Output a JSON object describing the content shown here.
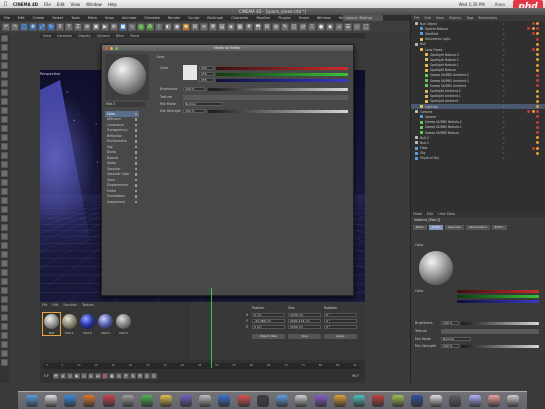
{
  "menubar": {
    "apple": "",
    "app": "CINEMA 4D",
    "items": [
      "File",
      "Edit",
      "View",
      "Window",
      "Help"
    ],
    "right": [
      "Wed 1:30 PM",
      "Anon"
    ]
  },
  "brand": {
    "logo": "phd"
  },
  "window": {
    "title": "CINEMA 4D - [space_scene.c4d *]"
  },
  "c4dmenu": {
    "items": [
      "File",
      "Edit",
      "Create",
      "Select",
      "Tools",
      "Mesh",
      "Snap",
      "Animate",
      "Simulate",
      "Render",
      "Sculpt",
      "MoGraph",
      "Character",
      "Pipeline",
      "Plugins",
      "Script",
      "Window",
      "Help"
    ],
    "layout": "Layout: Startup"
  },
  "viewport": {
    "menu": [
      "View",
      "Cameras",
      "Display",
      "Options",
      "Filter",
      "Panel"
    ],
    "label": "Perspective"
  },
  "material_editor": {
    "title": "Material Editor",
    "name": "Mat.3",
    "channels": [
      {
        "name": "Color",
        "on": true,
        "sel": true
      },
      {
        "name": "Diffusion",
        "on": false
      },
      {
        "name": "Luminance",
        "on": false
      },
      {
        "name": "Transparency",
        "on": false
      },
      {
        "name": "Reflection",
        "on": false
      },
      {
        "name": "Environment",
        "on": false
      },
      {
        "name": "Fog",
        "on": false
      },
      {
        "name": "Bump",
        "on": false
      },
      {
        "name": "Normal",
        "on": false
      },
      {
        "name": "Alpha",
        "on": false
      },
      {
        "name": "Specular",
        "on": true
      },
      {
        "name": "Specular Color",
        "on": false
      },
      {
        "name": "Glow",
        "on": false
      },
      {
        "name": "Displacement",
        "on": false
      },
      {
        "name": "Editor",
        "on": false
      },
      {
        "name": "Illumination",
        "on": false
      },
      {
        "name": "Assignment",
        "on": false
      }
    ],
    "section": "Color",
    "color_label": "Color",
    "r": "255",
    "g": "255",
    "b": "255",
    "brightness_label": "Brightness",
    "brightness": "100 %",
    "texture_label": "Texture",
    "mix_mode_label": "Mix Mode",
    "mix_mode": "Normal",
    "mix_strength_label": "Mix Strength",
    "mix_strength": "100 %"
  },
  "object_manager": {
    "menu": [
      "File",
      "Edit",
      "View",
      "Objects",
      "Tags",
      "Bookmarks"
    ],
    "rows": [
      {
        "name": "Null Object",
        "indent": 0,
        "color": "#b9b9b9",
        "tags": [
          "#c43a3a",
          "#e0a030"
        ]
      },
      {
        "name": "Sphere Nebula",
        "indent": 1,
        "color": "#5aa0e0",
        "tags": [
          "#c43a3a",
          "#e0a030",
          "#c43a3a"
        ]
      },
      {
        "name": "Starfield",
        "indent": 1,
        "color": "#5aa0e0",
        "tags": [
          "#c43a3a",
          "#e0a030"
        ]
      },
      {
        "name": "Volumetric Light",
        "indent": 1,
        "color": "#e0c050",
        "tags": [
          "#c43a3a"
        ]
      },
      {
        "name": "Null",
        "indent": 0,
        "color": "#b9b9b9",
        "tags": [
          "#e0a030"
        ]
      },
      {
        "name": "Lens Flares",
        "indent": 1,
        "color": "#e0c050",
        "tags": [
          "#c43a3a",
          "#e0a030"
        ]
      },
      {
        "name": "Spotlight Nebula.3",
        "indent": 2,
        "color": "#e0c050",
        "tags": [
          "#e0a030"
        ]
      },
      {
        "name": "Spotlight Nebula.2",
        "indent": 2,
        "color": "#e0c050",
        "tags": [
          "#e0a030"
        ]
      },
      {
        "name": "Spotlight Nebula.1",
        "indent": 2,
        "color": "#e0c050",
        "tags": [
          "#e0a030"
        ]
      },
      {
        "name": "Spotlight Nebula",
        "indent": 2,
        "color": "#e0c050",
        "tags": [
          "#e0a030"
        ]
      },
      {
        "name": "Sweep NURBS Ambient.2",
        "indent": 2,
        "color": "#5ad05a",
        "tags": [
          "#c43a3a"
        ]
      },
      {
        "name": "Sweep NURBS Ambient.1",
        "indent": 2,
        "color": "#5ad05a",
        "tags": [
          "#c43a3a"
        ]
      },
      {
        "name": "Sweep NURBS Ambient",
        "indent": 2,
        "color": "#5ad05a",
        "tags": [
          "#c43a3a"
        ]
      },
      {
        "name": "Spotlight Ambient.2",
        "indent": 2,
        "color": "#e0c050",
        "tags": [
          "#e0a030"
        ]
      },
      {
        "name": "Spotlight Ambient.1",
        "indent": 2,
        "color": "#e0c050",
        "tags": [
          "#e0a030"
        ]
      },
      {
        "name": "Spotlight Ambient",
        "indent": 2,
        "color": "#e0c050",
        "tags": [
          "#e0a030"
        ]
      },
      {
        "name": "Lighting",
        "indent": 1,
        "color": "#e0c050",
        "tags": [
          "#e0a030"
        ],
        "sel": true
      },
      {
        "name": "Camera",
        "indent": 0,
        "color": "#b9b9b9",
        "tags": [
          "#c43a3a",
          "#e0a030",
          "#c43a3a"
        ]
      },
      {
        "name": "Sphere",
        "indent": 1,
        "color": "#5aa0e0",
        "tags": [
          "#c43a3a"
        ]
      },
      {
        "name": "Sweep NURBS Nebula.2",
        "indent": 1,
        "color": "#5ad05a",
        "tags": [
          "#c43a3a"
        ]
      },
      {
        "name": "Sweep NURBS Nebula.1",
        "indent": 1,
        "color": "#5ad05a",
        "tags": [
          "#c43a3a"
        ]
      },
      {
        "name": "Sweep NURBS Nebula",
        "indent": 1,
        "color": "#5ad05a",
        "tags": [
          "#c43a3a"
        ]
      },
      {
        "name": "Null.2",
        "indent": 0,
        "color": "#b9b9b9",
        "tags": [
          "#e0a030"
        ]
      },
      {
        "name": "Null.1",
        "indent": 0,
        "color": "#b9b9b9",
        "tags": [
          "#e0a030"
        ]
      },
      {
        "name": "Floor",
        "indent": 0,
        "color": "#5aa0e0",
        "tags": [
          "#c43a3a",
          "#e0a030"
        ]
      },
      {
        "name": "Sky",
        "indent": 0,
        "color": "#5aa0e0",
        "tags": [
          "#e0a030"
        ]
      },
      {
        "name": "Physical Sky",
        "indent": 0,
        "color": "#5aa0e0",
        "tags": []
      }
    ]
  },
  "attributes": {
    "tabs": [
      "Mode",
      "Edit",
      "User Data"
    ],
    "mode_label": "Material [Mat.3]",
    "subtabs": [
      {
        "label": "Basic",
        "active": false
      },
      {
        "label": "Color",
        "active": true
      },
      {
        "label": "Specular",
        "active": false
      },
      {
        "label": "Illumination",
        "active": false
      },
      {
        "label": "Editor",
        "active": false
      }
    ],
    "section": "Color",
    "color_label": "Color",
    "brightness_label": "Brightness",
    "brightness": "100 %",
    "texture_label": "Texture",
    "mix_mode_label": "Mix Mode",
    "mix_mode": "Normal",
    "mix_strength_label": "Mix Strength",
    "mix_strength": "100 %"
  },
  "material_manager": {
    "menu": [
      "File",
      "Edit",
      "Function",
      "Texture"
    ],
    "materials": [
      {
        "name": "Mat",
        "colors": [
          "#f0f0f0",
          "#9a9a9a",
          "#454545"
        ]
      },
      {
        "name": "Mat.1",
        "colors": [
          "#e8e6d8",
          "#8e8a78",
          "#3a3a34"
        ]
      },
      {
        "name": "Mat.2",
        "colors": [
          "#9aa8ff",
          "#2a3ab0",
          "#101034"
        ]
      },
      {
        "name": "Mat.3",
        "colors": [
          "#d0d6ff",
          "#5a62b0",
          "#181834"
        ]
      },
      {
        "name": "Mat.4",
        "colors": [
          "#e0e0e0",
          "#8a8a8a",
          "#3a3a3a"
        ]
      }
    ]
  },
  "coordinates": {
    "headers": [
      "Position",
      "Size",
      "Rotation"
    ],
    "rows": [
      {
        "axis": "X",
        "pos": "0 cm",
        "size": "1030 cm",
        "rot": "0 °",
        "rot_axis": "H"
      },
      {
        "axis": "Y",
        "pos": "-44.386 cm",
        "size": "2002.112 cm",
        "rot": "0 °",
        "rot_axis": "P"
      },
      {
        "axis": "Z",
        "pos": "0 cm",
        "size": "1030 cm",
        "rot": "0 °",
        "rot_axis": "B"
      }
    ],
    "mode": "Object (Rel)",
    "size_mode": "Size",
    "apply": "Apply"
  },
  "timeline": {
    "ticks": [
      "0",
      "5",
      "10",
      "15",
      "20",
      "25",
      "30",
      "35",
      "40",
      "45",
      "50",
      "55",
      "60",
      "65",
      "70",
      "75",
      "80",
      "85",
      "90"
    ],
    "frame": "0 F",
    "end": "90 F"
  },
  "dock": {
    "apps": [
      "#5aa0e0",
      "#e0e0e0",
      "#3a8ae0",
      "#e07a30",
      "#d04050",
      "#a0a0a0",
      "#50b050",
      "#e0c050",
      "#7060c0",
      "#c0c0c0",
      "#3a6ed0",
      "#e05050",
      "#404040",
      "#60a0e0",
      "#d0d0d0",
      "#8a5ad0",
      "#e0a030",
      "#50c0c0",
      "#c04040",
      "#a0c050",
      "#3050a0",
      "#e0e0e0",
      "#606060",
      "#b0b0ff",
      "#f0a0a0",
      "#d0d0d0"
    ]
  }
}
